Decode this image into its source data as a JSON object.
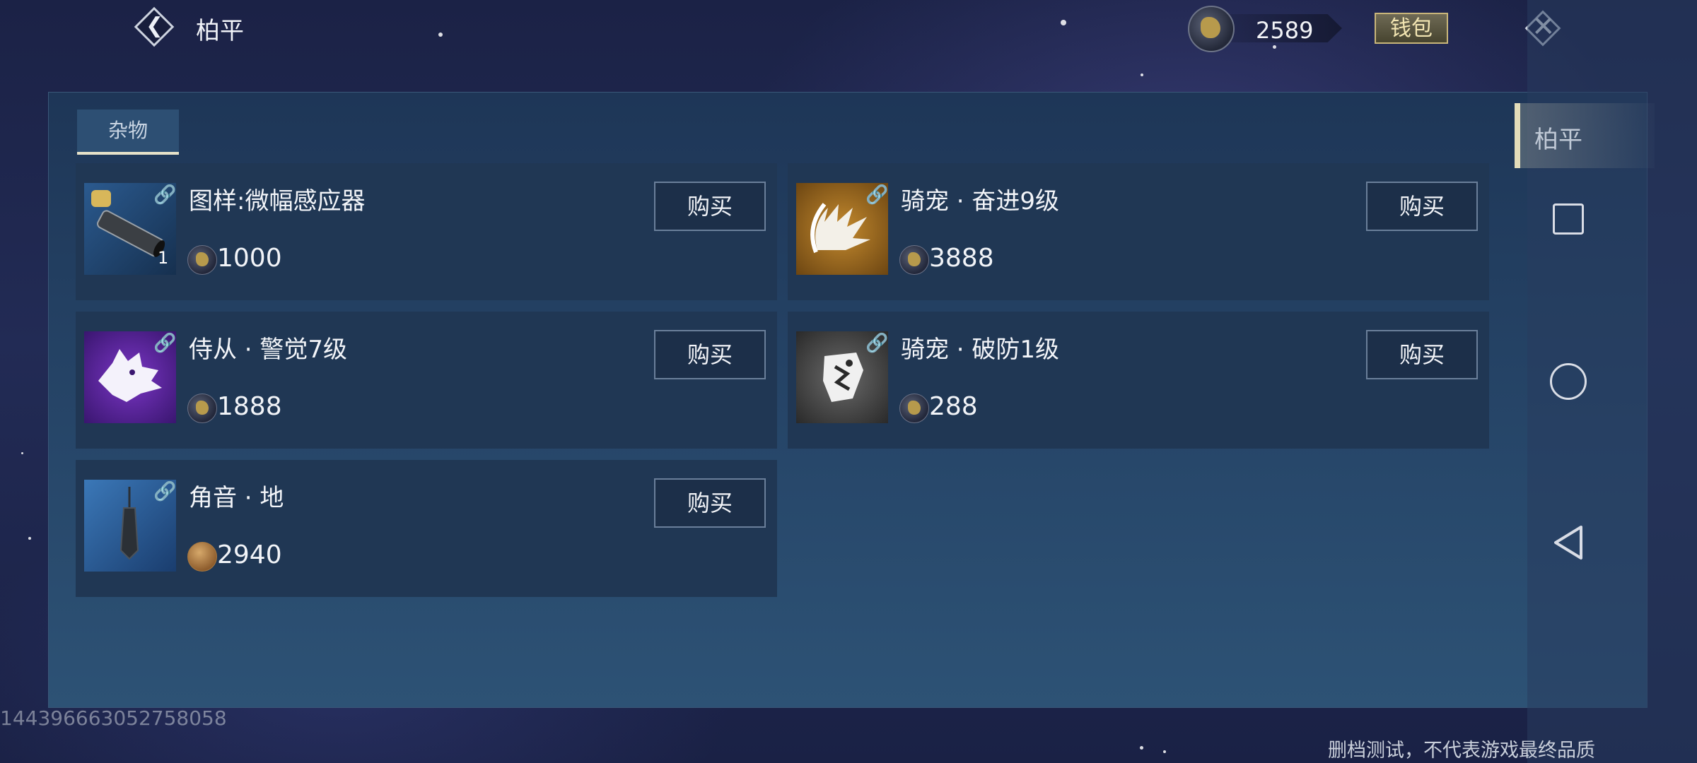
{
  "header": {
    "title": "柏平",
    "currency_amount": "2589",
    "wallet_label": "钱包"
  },
  "tabs": [
    {
      "label": "杂物",
      "active": true
    }
  ],
  "items": [
    {
      "name": "图样:微幅感应器",
      "price": "1000",
      "quantity": "1",
      "currency": "coin",
      "buy_label": "购买",
      "icon": "pipe-icon"
    },
    {
      "name": "骑宠 · 奋进9级",
      "price": "3888",
      "currency": "coin",
      "buy_label": "购买",
      "icon": "claw-slash-icon"
    },
    {
      "name": "侍从 · 警觉7级",
      "price": "1888",
      "currency": "coin",
      "buy_label": "购买",
      "icon": "wolf-head-icon"
    },
    {
      "name": "骑宠 · 破防1级",
      "price": "288",
      "currency": "coin",
      "buy_label": "购买",
      "icon": "armor-break-icon"
    },
    {
      "name": "角音 · 地",
      "price": "2940",
      "currency": "bronze-coin",
      "buy_label": "购买",
      "icon": "pendant-icon"
    }
  ],
  "sidebar": {
    "tab_label": "柏平"
  },
  "overlay": {
    "uid": "1443966630527​58058",
    "note": "删档测试，不代表游戏最终品质"
  },
  "colors": {
    "background": "#1e2550",
    "panel": "#23405f",
    "card": "#203754",
    "wallet": "#c9b67a"
  }
}
